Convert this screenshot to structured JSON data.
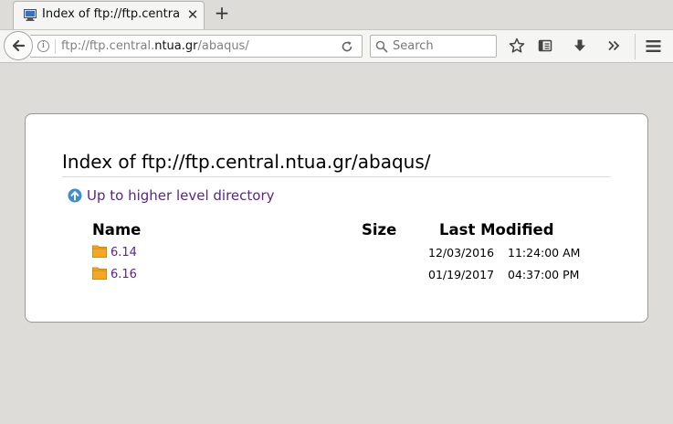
{
  "tab": {
    "title": "Index of ftp://ftp.central.ntua.gr/abaqus/",
    "favicon": "directory-listing-icon"
  },
  "navbar": {
    "url_prefix": "ftp://ftp.central.",
    "url_domain": "ntua.gr",
    "url_suffix": "/abaqus/",
    "search_placeholder": "Search"
  },
  "page": {
    "title": "Index of ftp://ftp.central.ntua.gr/abaqus/",
    "up_link": "Up to higher level directory",
    "columns": {
      "name": "Name",
      "size": "Size",
      "modified": "Last Modified"
    },
    "entries": [
      {
        "name": "6.14",
        "size": "",
        "date": "12/03/2016",
        "time": "11:24:00 AM"
      },
      {
        "name": "6.16",
        "size": "",
        "date": "01/19/2017",
        "time": "04:37:00 PM"
      }
    ]
  },
  "colors": {
    "link": "#5a2590",
    "folder": "#f5a623",
    "up_icon": "#3a8fd0"
  }
}
